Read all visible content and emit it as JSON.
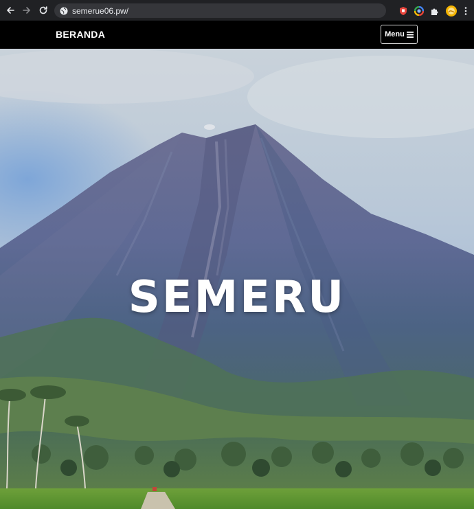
{
  "browser": {
    "url": "semerue06.pw/",
    "icons": [
      "back-arrow-icon",
      "forward-arrow-icon",
      "reload-icon",
      "site-info-icon",
      "extension-red-icon",
      "extension-colorful-icon",
      "puzzle-icon",
      "profile-avatar",
      "kebab-menu-icon"
    ]
  },
  "site_nav": {
    "brand": "BERANDA",
    "menu_label": "Menu",
    "menu_icon": "hamburger-icon"
  },
  "hero": {
    "title": "SEMERU"
  },
  "colors": {
    "chrome_bg": "#202124",
    "omnibox_bg": "#35363a",
    "nav_bg": "#000000",
    "text": "#ffffff"
  }
}
